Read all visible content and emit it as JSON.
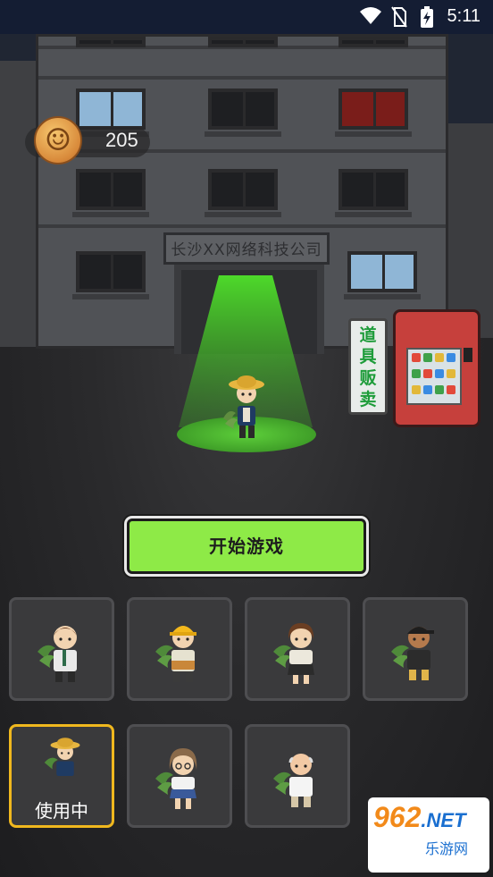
{
  "status_bar": {
    "time": "5:11",
    "icons": [
      "wifi-icon",
      "no-sim-icon",
      "battery-charging-icon"
    ]
  },
  "scene": {
    "building_sign": "长沙XX网络科技公司",
    "vending_sign": [
      "道",
      "具",
      "贩",
      "卖"
    ]
  },
  "currency": {
    "icon": "coin-icon",
    "amount": "205"
  },
  "start_button": {
    "label": "开始游戏"
  },
  "characters": {
    "in_use_label": "使用中",
    "slots": [
      {
        "name": "office-worker-glasses",
        "in_use": false
      },
      {
        "name": "construction-worker",
        "in_use": false
      },
      {
        "name": "office-lady",
        "in_use": false
      },
      {
        "name": "hiphop-cap",
        "in_use": false
      },
      {
        "name": "farmer-straw-hat",
        "in_use": true
      },
      {
        "name": "schoolgirl-glasses",
        "in_use": false
      },
      {
        "name": "bald-grandpa",
        "in_use": false
      }
    ]
  },
  "watermark": {
    "main": "962",
    "net": ".NET",
    "sub": "乐游网"
  },
  "colors": {
    "start_button": "#8eea47",
    "in_use_border": "#f0b81e",
    "spotlight": "#4fd12a",
    "coin": "#d8893a"
  }
}
